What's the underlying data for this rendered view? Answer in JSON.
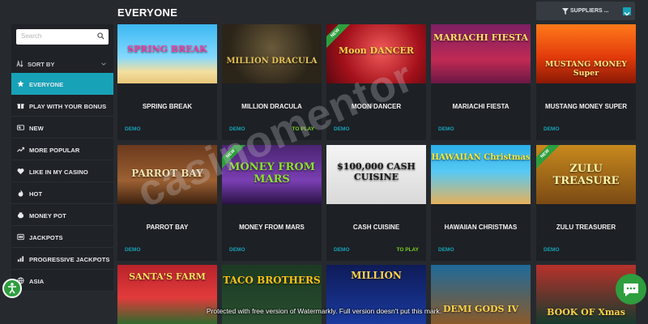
{
  "header": {
    "title": "EVERYONE",
    "suppliers_label": "SUPPLIERS ..."
  },
  "sidebar": {
    "search_placeholder": "Search",
    "sort_label": "SORT BY",
    "items": [
      {
        "label": "EVERYONE",
        "icon": "star-icon",
        "active": true
      },
      {
        "label": "PLAY WITH YOUR BONUS",
        "icon": "gift-icon",
        "active": false
      },
      {
        "label": "NEW",
        "icon": "new-icon",
        "active": false
      },
      {
        "label": "MORE POPULAR",
        "icon": "trending-icon",
        "active": false
      },
      {
        "label": "LIKE IN MY CASINO",
        "icon": "heart-icon",
        "active": false
      },
      {
        "label": "HOT",
        "icon": "fire-icon",
        "active": false
      },
      {
        "label": "MONEY POT",
        "icon": "money-pot-icon",
        "active": false
      },
      {
        "label": "JACKPOTS",
        "icon": "jackpot-icon",
        "active": false
      },
      {
        "label": "PROGRESSIVE JACKPOTS",
        "icon": "progressive-icon",
        "active": false
      },
      {
        "label": "ASIA",
        "icon": "asia-icon",
        "active": false
      }
    ]
  },
  "labels": {
    "demo": "DEMO",
    "to_play": "TO PLAY",
    "new_badge": "NEW"
  },
  "games": [
    {
      "name": "SPRING BREAK",
      "art": "SPRING BREAK",
      "to_play": false,
      "new": false
    },
    {
      "name": "MILLION DRACULA",
      "art": "MILLION DRACULA",
      "to_play": true,
      "new": false
    },
    {
      "name": "MOON DANCER",
      "art": "Moon DANCER",
      "to_play": false,
      "new": true
    },
    {
      "name": "MARIACHI FIESTA",
      "art": "MARIACHI FIESTA",
      "to_play": false,
      "new": false
    },
    {
      "name": "MUSTANG MONEY SUPER",
      "art": "MUSTANG MONEY Super",
      "to_play": false,
      "new": false
    },
    {
      "name": "PARROT BAY",
      "art": "PARROT BAY",
      "to_play": false,
      "new": false
    },
    {
      "name": "MONEY FROM MARS",
      "art": "MONEY FROM MARS",
      "to_play": false,
      "new": true
    },
    {
      "name": "CASH CUISINE",
      "art": "$100,000 CASH CUISINE",
      "to_play": true,
      "new": false
    },
    {
      "name": "HAWAIIAN CHRISTMAS",
      "art": "HAWAIIAN Christmas",
      "to_play": false,
      "new": false
    },
    {
      "name": "ZULU TREASURER",
      "art": "ZULU TREASURE",
      "to_play": false,
      "new": true
    },
    {
      "name": "",
      "art": "SANTA'S FARM",
      "to_play": false,
      "new": false
    },
    {
      "name": "",
      "art": "TACO BROTHERS",
      "to_play": false,
      "new": false
    },
    {
      "name": "",
      "art": "MILLION",
      "to_play": false,
      "new": false
    },
    {
      "name": "",
      "art": "DEMI GODS IV",
      "to_play": false,
      "new": false
    },
    {
      "name": "",
      "art": "BOOK OF Xmas",
      "to_play": false,
      "new": false
    }
  ],
  "watermark": "casinomentor",
  "notice": "Protected with free version of Watermarkly. Full version doesn't put this mark.",
  "colors": {
    "accent": "#17a2b8",
    "to_play": "#7ed321",
    "new_badge": "#2e9e3e",
    "background": "#262a2f",
    "card": "#1d2025"
  }
}
